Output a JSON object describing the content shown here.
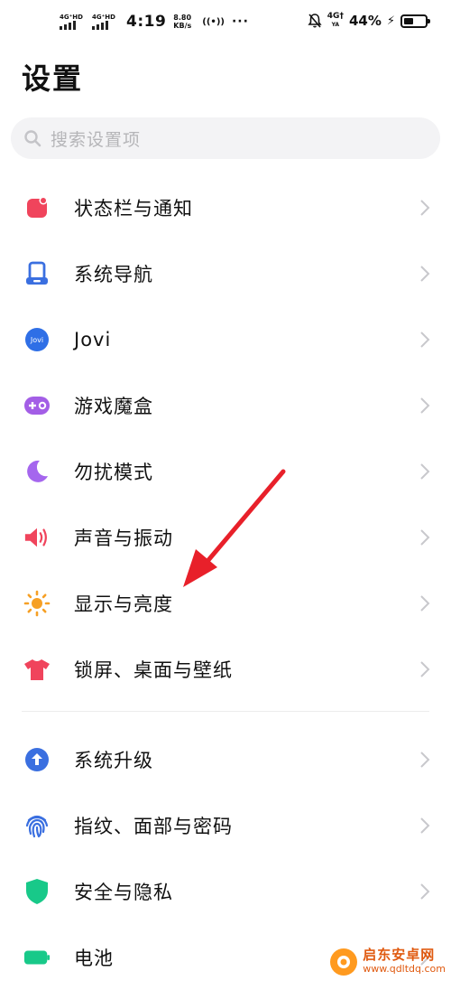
{
  "status_bar": {
    "sim1": "4G⁺HD",
    "sim2": "4G⁺HD",
    "time": "4:19",
    "speed_value": "8.80",
    "speed_unit": "KB/s",
    "hotspot": "((•))",
    "more": "···",
    "network_top": "4G†",
    "network_bottom": "YA",
    "battery_percent_label": "44%",
    "battery_level": 0.44,
    "charging_icon": "⚡"
  },
  "page": {
    "title": "设置"
  },
  "search": {
    "placeholder": "搜索设置项",
    "icon": "search-icon"
  },
  "groups": [
    {
      "items": [
        {
          "label": "状态栏与通知",
          "icon": "notification-square-icon",
          "color": "#f0445c"
        },
        {
          "label": "系统导航",
          "icon": "navigation-icon",
          "color": "#3a6fe0"
        },
        {
          "label": "Jovi",
          "icon": "jovi-icon",
          "icon_text": "Jovi",
          "color": "#2f6fe6"
        },
        {
          "label": "游戏魔盒",
          "icon": "gamepad-icon",
          "color": "#a35ee6"
        },
        {
          "label": "勿扰模式",
          "icon": "moon-icon",
          "color": "#a566ee"
        },
        {
          "label": "声音与振动",
          "icon": "speaker-icon",
          "color": "#f0445c"
        },
        {
          "label": "显示与亮度",
          "icon": "sun-icon",
          "color": "#f6a025"
        },
        {
          "label": "锁屏、桌面与壁纸",
          "icon": "shirt-icon",
          "color": "#f0445c"
        }
      ]
    },
    {
      "items": [
        {
          "label": "系统升级",
          "icon": "upgrade-arrow-icon",
          "color": "#3a6fe0"
        },
        {
          "label": "指纹、面部与密码",
          "icon": "fingerprint-icon",
          "color": "#3a6fe0"
        },
        {
          "label": "安全与隐私",
          "icon": "shield-icon",
          "color": "#18c989"
        },
        {
          "label": "电池",
          "icon": "battery-icon",
          "color": "#18c989"
        }
      ]
    }
  ],
  "watermark": {
    "name": "启东安卓网",
    "url": "www.qdltdq.com"
  }
}
